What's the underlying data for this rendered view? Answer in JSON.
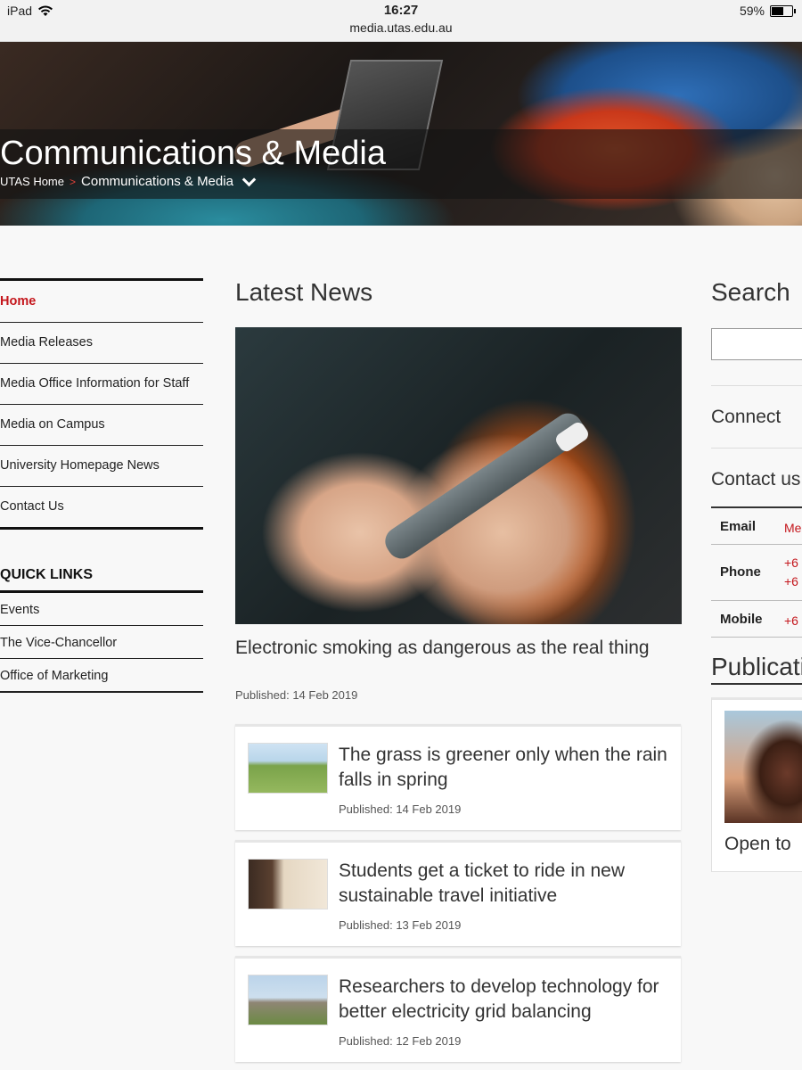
{
  "status_bar": {
    "device": "iPad",
    "time": "16:27",
    "url": "media.utas.edu.au",
    "battery": "59%",
    "battery_level": 0.59
  },
  "hero": {
    "title": "Communications & Media",
    "breadcrumb_home": "UTAS Home",
    "breadcrumb_separator": ">",
    "breadcrumb_current": "Communications & Media"
  },
  "left_nav": {
    "items": [
      {
        "label": "Home",
        "active": true
      },
      {
        "label": "Media Releases"
      },
      {
        "label": "Media Office Information for Staff"
      },
      {
        "label": "Media on Campus"
      },
      {
        "label": "University Homepage News"
      },
      {
        "label": "Contact Us"
      }
    ],
    "quick_links_title": "QUICK LINKS",
    "quick_links": [
      {
        "label": "Events"
      },
      {
        "label": "The Vice-Chancellor"
      },
      {
        "label": "Office of Marketing"
      }
    ]
  },
  "main": {
    "heading": "Latest News",
    "feature": {
      "title": "Electronic smoking as dangerous as the real thing",
      "date": "Published: 14 Feb 2019"
    },
    "cards": [
      {
        "title": "The grass is greener only when the rain falls in spring",
        "date": "Published: 14 Feb 2019"
      },
      {
        "title": "Students get a ticket to ride in new sustainable travel initiative",
        "date": "Published: 13 Feb 2019"
      },
      {
        "title": "Researchers to develop technology for better electricity grid balancing",
        "date": "Published: 12 Feb 2019"
      }
    ]
  },
  "right": {
    "search_heading": "Search",
    "connect_heading": "Connect",
    "contact_heading": "Contact us",
    "contacts": [
      {
        "label": "Email",
        "value": "Me"
      },
      {
        "label": "Phone",
        "value": "+6",
        "value2": "+6"
      },
      {
        "label": "Mobile",
        "value": "+6"
      }
    ],
    "publications_heading": "Publications",
    "publication_caption": "Open to"
  },
  "colors": {
    "accent_red": "#c4161c",
    "text_dark": "#333333",
    "background": "#f8f8f8"
  }
}
